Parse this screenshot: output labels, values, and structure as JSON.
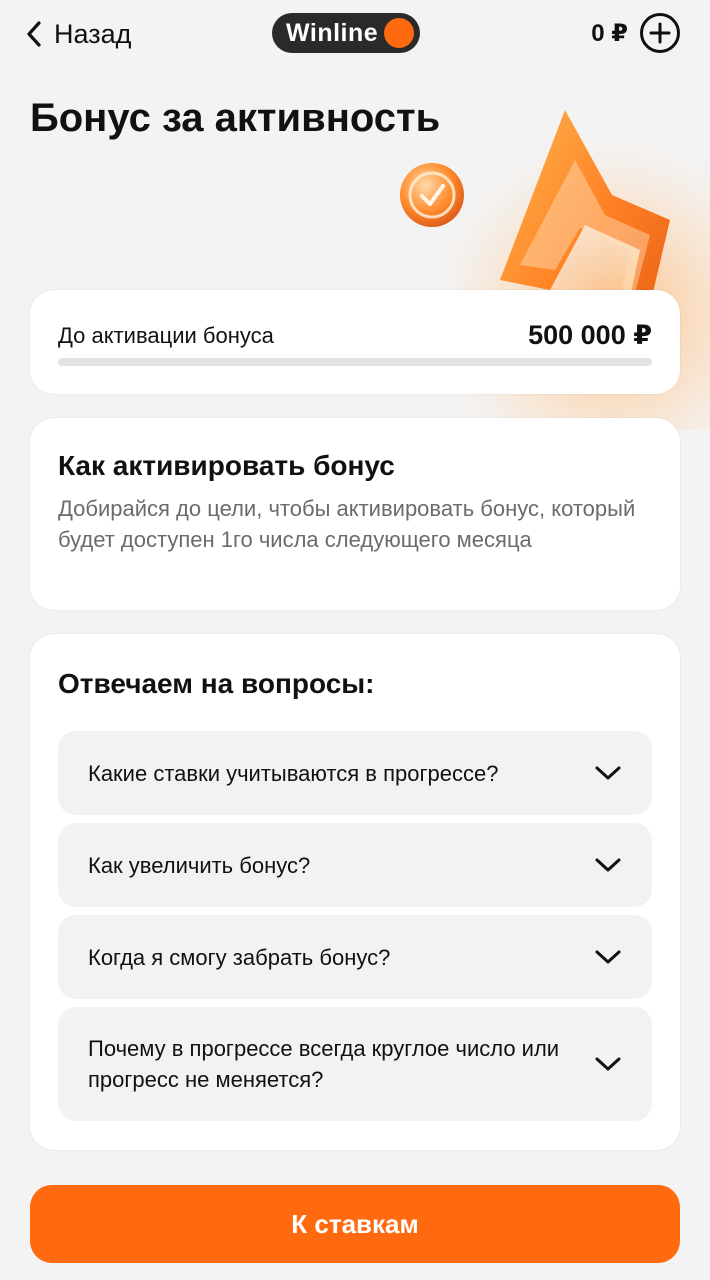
{
  "header": {
    "back_label": "Назад",
    "logo_text": "Winline",
    "balance": "0 ₽"
  },
  "page_title": "Бонус за активность",
  "progress": {
    "label": "До активации бонуса",
    "value": "500 000 ₽",
    "fraction": 0
  },
  "info": {
    "title": "Как активировать бонус",
    "text": "Добирайся до цели, чтобы активировать бонус, который будет доступен 1го числа следующего месяца"
  },
  "faq": {
    "title": "Отвечаем на вопросы:",
    "items": [
      {
        "question": "Какие ставки учитываются в прогрессе?"
      },
      {
        "question": "Как увеличить бонус?"
      },
      {
        "question": "Когда я смогу забрать бонус?"
      },
      {
        "question": "Почему в прогрессе всегда круглое число или прогресс не меняется?"
      }
    ]
  },
  "cta_label": "К ставкам",
  "colors": {
    "accent": "#ff6a10",
    "background": "#f3f3f3",
    "card": "#ffffff",
    "muted_text": "#6b6b6b"
  },
  "icons": [
    "chevron-left-icon",
    "winline-logo",
    "plus-circle-icon",
    "coin-check-icon",
    "lightning-bolt-illustration",
    "chevron-down-icon"
  ]
}
